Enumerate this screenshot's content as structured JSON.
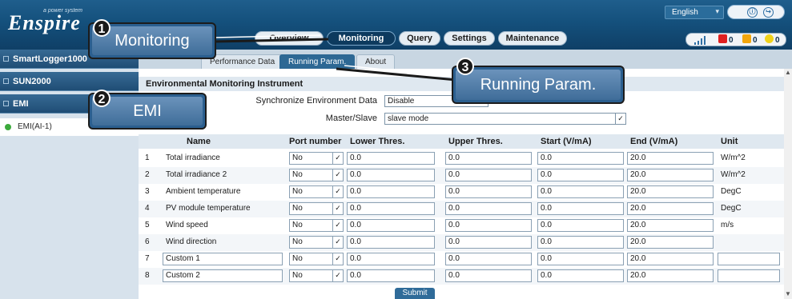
{
  "header": {
    "logo": "Enspire",
    "logo_tag": "a power system",
    "language": "English",
    "language_caret": "▾",
    "user_icons": [
      "ⓘ",
      "↪"
    ]
  },
  "topnav": {
    "items": [
      {
        "label": "Overview"
      },
      {
        "label": "Monitoring"
      },
      {
        "label": "Query"
      },
      {
        "label": "Settings"
      },
      {
        "label": "Maintenance"
      }
    ],
    "active": "Monitoring"
  },
  "alarms": [
    {
      "count": "0",
      "color": "#e02020"
    },
    {
      "count": "0",
      "color": "#f2a60c"
    },
    {
      "count": "0",
      "color": "#f0d21a"
    }
  ],
  "sidebar": {
    "items": [
      {
        "label": "SmartLogger1000"
      },
      {
        "label": "SUN2000"
      },
      {
        "label": "EMI"
      }
    ],
    "sub_item": "EMI(AI-1)"
  },
  "tabs": [
    {
      "label": "Performance Data"
    },
    {
      "label": "Running Param."
    },
    {
      "label": "About"
    }
  ],
  "section_title": "Environmental Monitoring Instrument",
  "form": {
    "sync_label": "Synchronize Environment Data",
    "sync_value": "Disable",
    "master_label": "Master/Slave",
    "master_value": "slave mode",
    "caret": "✓"
  },
  "table": {
    "headers": [
      "Name",
      "Port number",
      "Lower Thres.",
      "Upper Thres.",
      "Start (V/mA)",
      "End (V/mA)",
      "Unit"
    ],
    "rows": [
      {
        "no": "1",
        "name": "Total irradiance",
        "port": "No",
        "lower": "0.0",
        "upper": "0.0",
        "start": "0.0",
        "end": "20.0",
        "unit": "W/m^2"
      },
      {
        "no": "2",
        "name": "Total irradiance 2",
        "port": "No",
        "lower": "0.0",
        "upper": "0.0",
        "start": "0.0",
        "end": "20.0",
        "unit": "W/m^2"
      },
      {
        "no": "3",
        "name": "Ambient temperature",
        "port": "No",
        "lower": "0.0",
        "upper": "0.0",
        "start": "0.0",
        "end": "20.0",
        "unit": "DegC"
      },
      {
        "no": "4",
        "name": "PV module temperature",
        "port": "No",
        "lower": "0.0",
        "upper": "0.0",
        "start": "0.0",
        "end": "20.0",
        "unit": "DegC"
      },
      {
        "no": "5",
        "name": "Wind speed",
        "port": "No",
        "lower": "0.0",
        "upper": "0.0",
        "start": "0.0",
        "end": "20.0",
        "unit": "m/s"
      },
      {
        "no": "6",
        "name": "Wind direction",
        "port": "No",
        "lower": "0.0",
        "upper": "0.0",
        "start": "0.0",
        "end": "20.0",
        "unit": ""
      },
      {
        "no": "7",
        "name": "Custom 1",
        "port": "No",
        "lower": "0.0",
        "upper": "0.0",
        "start": "0.0",
        "end": "20.0",
        "unit": ""
      },
      {
        "no": "8",
        "name": "Custom 2",
        "port": "No",
        "lower": "0.0",
        "upper": "0.0",
        "start": "0.0",
        "end": "20.0",
        "unit": ""
      }
    ]
  },
  "submit_label": "Submit",
  "callouts": [
    {
      "number": "1",
      "label": "Monitoring"
    },
    {
      "number": "2",
      "label": "EMI"
    },
    {
      "number": "3",
      "label": "Running Param."
    }
  ],
  "colors": {
    "header": "#14507c",
    "accent": "#2d6894",
    "callout": "#3f6d99"
  }
}
